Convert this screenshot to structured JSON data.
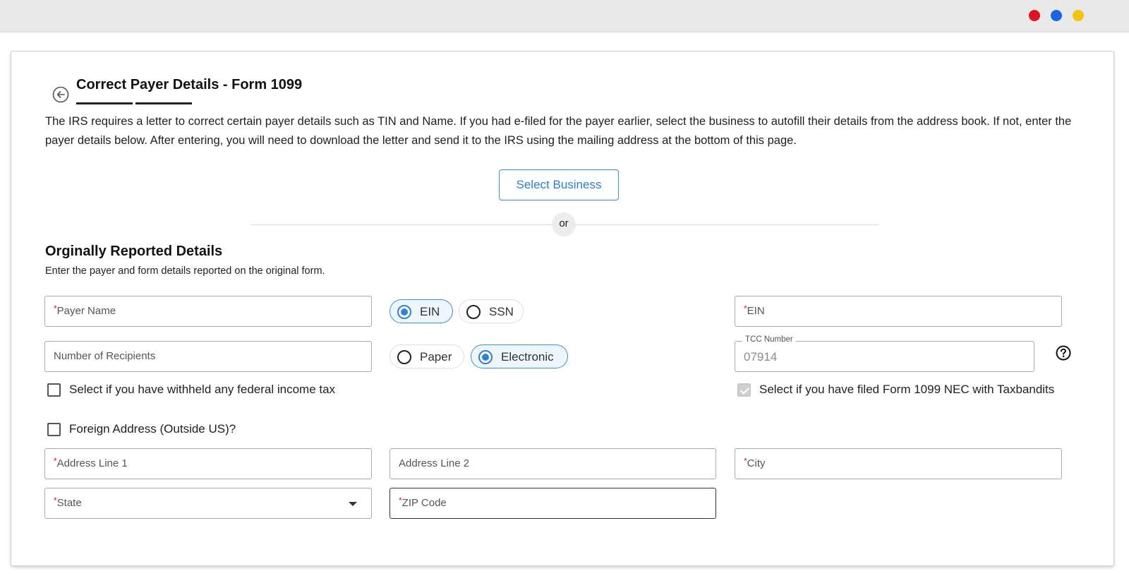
{
  "window": {
    "dots": {
      "red": "#e0141e",
      "blue": "#1b66e0",
      "yellow": "#f2c40f"
    }
  },
  "header": {
    "title": "Correct Payer Details - Form 1099",
    "back_icon": "arrow-left-circle-icon"
  },
  "intro": {
    "text": "The IRS requires a letter to correct certain payer details such as TIN and Name. If you had e-filed for the payer earlier, select the business to autofill their details from the address book. If not, enter the payer details below. After entering, you will need to download the letter and send it to the IRS using the mailing address at the bottom of this page."
  },
  "select_business": {
    "label": "Select Business"
  },
  "divider": {
    "label": "or"
  },
  "section": {
    "title": "Orginally Reported Details",
    "subtitle": "Enter the payer and form details reported on the original form."
  },
  "form": {
    "payer_name": {
      "placeholder": "Payer Name",
      "required": true
    },
    "tin_type": {
      "options": [
        "EIN",
        "SSN"
      ],
      "selected": "EIN"
    },
    "ein": {
      "placeholder": "EIN",
      "required": true
    },
    "num_recipients": {
      "placeholder": "Number of Recipients"
    },
    "filing_method": {
      "options": [
        "Paper",
        "Electronic"
      ],
      "selected": "Electronic"
    },
    "tcc": {
      "label": "TCC Number",
      "value": "07914"
    },
    "withheld_tax": {
      "label": "Select if you have withheld any federal income tax",
      "checked": false
    },
    "filed_nec": {
      "label": "Select if you have filed Form 1099 NEC with Taxbandits",
      "checked": true
    },
    "foreign_address": {
      "label": "Foreign Address (Outside US)?",
      "checked": false
    },
    "address1": {
      "placeholder": "Address Line 1",
      "required": true
    },
    "address2": {
      "placeholder": "Address Line 2"
    },
    "city": {
      "placeholder": "City",
      "required": true
    },
    "state": {
      "placeholder": "State",
      "required": true
    },
    "zip": {
      "placeholder": "ZIP Code",
      "required": true
    }
  },
  "colors": {
    "accent": "#2f80d6",
    "required": "#d91c1c"
  }
}
